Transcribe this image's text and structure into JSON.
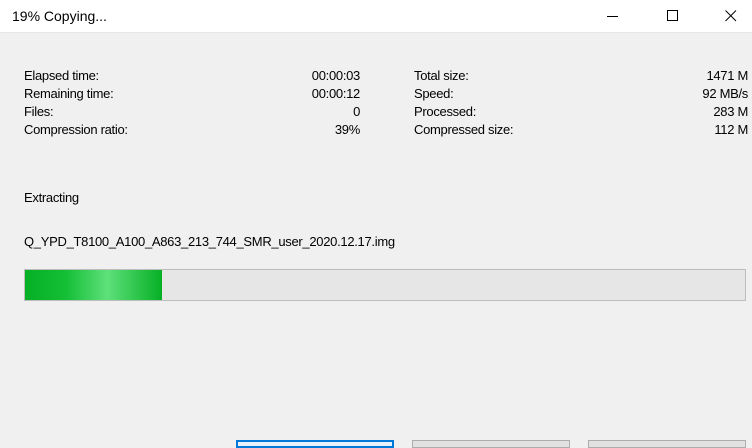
{
  "window": {
    "title": "19% Copying..."
  },
  "stats_left": [
    {
      "label": "Elapsed time:",
      "value": "00:00:03"
    },
    {
      "label": "Remaining time:",
      "value": "00:00:12"
    },
    {
      "label": "Files:",
      "value": "0"
    },
    {
      "label": "Compression ratio:",
      "value": "39%"
    }
  ],
  "stats_right": [
    {
      "label": "Total size:",
      "value": "1471 M"
    },
    {
      "label": "Speed:",
      "value": "92 MB/s"
    },
    {
      "label": "Processed:",
      "value": "283 M"
    },
    {
      "label": "Compressed size:",
      "value": "112 M"
    }
  ],
  "status": "Extracting",
  "current_file": "Q_YPD_T8100_A100_A863_213_744_SMR_user_2020.12.17.img",
  "progress": {
    "percent": 19,
    "color": "#06b025"
  },
  "icons": {
    "minimize": "minimize-icon",
    "maximize": "maximize-icon",
    "close": "close-icon"
  }
}
